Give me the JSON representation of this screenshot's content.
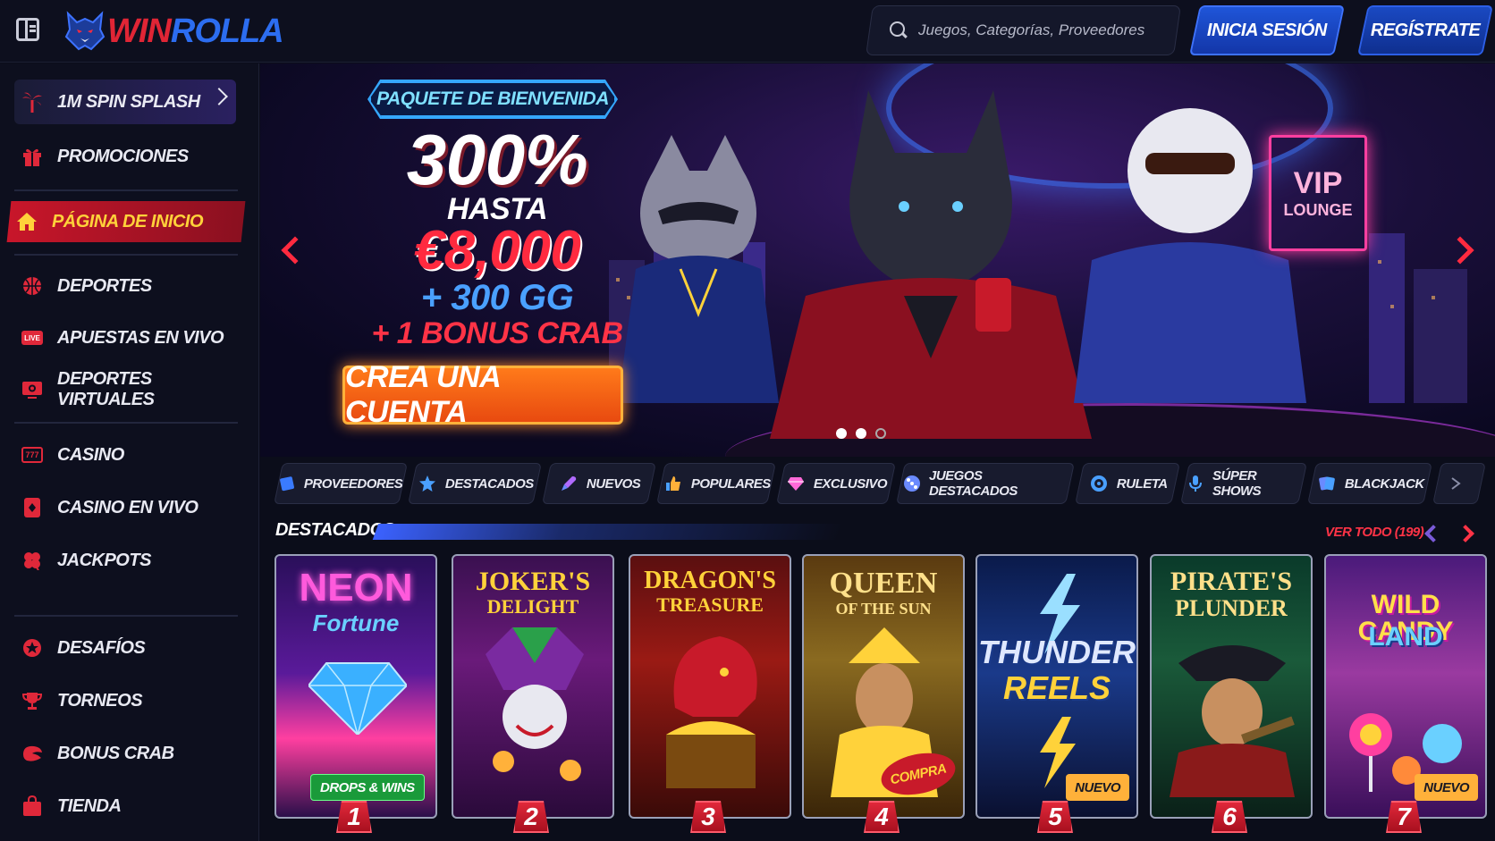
{
  "header": {
    "logo_win": "WIN",
    "logo_rolla": "ROLLA",
    "search_placeholder": "Juegos, Categorías, Proveedores",
    "login_label": "INICIA SESIÓN",
    "register_label": "REGÍSTRATE"
  },
  "sidebar": {
    "promo": {
      "label": "1M SPIN SPLASH",
      "icon": "palm-tree-icon"
    },
    "items": [
      {
        "label": "PROMOCIONES",
        "icon": "gift-icon"
      },
      {
        "label": "PÁGINA DE INICIO",
        "icon": "home-icon",
        "active": true
      },
      {
        "label": "DEPORTES",
        "icon": "basketball-icon"
      },
      {
        "label": "APUESTAS EN VIVO",
        "icon": "live-icon"
      },
      {
        "label": "DEPORTES VIRTUALES",
        "icon": "monitor-icon"
      },
      {
        "label": "CASINO",
        "icon": "slot-777-icon"
      },
      {
        "label": "CASINO EN VIVO",
        "icon": "card-icon"
      },
      {
        "label": "JACKPOTS",
        "icon": "clover-icon"
      },
      {
        "label": "DESAFÍOS",
        "icon": "star-badge-icon"
      },
      {
        "label": "TORNEOS",
        "icon": "trophy-icon"
      },
      {
        "label": "BONUS CRAB",
        "icon": "crab-claw-icon"
      },
      {
        "label": "TIENDA",
        "icon": "shopping-bag-icon"
      }
    ],
    "live_badge": "LIVE",
    "slot_badge": "777"
  },
  "hero": {
    "badge": "PAQUETE DE BIENVENIDA",
    "percent": "300%",
    "upto": "HASTA",
    "amount": "€8,000",
    "gg": "+ 300 GG",
    "crab": "+ 1 BONUS CRAB",
    "cta": "CREA UNA CUENTA",
    "vip_big": "VIP",
    "vip_small": "LOUNGE",
    "slides_total": 3,
    "slide_active": 2
  },
  "tabs": [
    {
      "label": "PROVEEDORES",
      "icon": "provider-icon",
      "color": "#3a7bff"
    },
    {
      "label": "DESTACADOS",
      "icon": "star-icon",
      "color": "#4aa0ff"
    },
    {
      "label": "NUEVOS",
      "icon": "rocket-icon",
      "color": "#b06aff"
    },
    {
      "label": "POPULARES",
      "icon": "thumbs-up-icon",
      "color": "#4aa0ff"
    },
    {
      "label": "EXCLUSIVO",
      "icon": "diamond-icon",
      "color": "#ff6ad8"
    },
    {
      "label": "JUEGOS DESTACADOS",
      "icon": "dice-icon",
      "color": "#6a8aff"
    },
    {
      "label": "RULETA",
      "icon": "roulette-icon",
      "color": "#4aa0ff"
    },
    {
      "label": "SÚPER SHOWS",
      "icon": "microphone-icon",
      "color": "#4aa0ff"
    },
    {
      "label": "BLACKJACK",
      "icon": "blackjack-icon",
      "color": "#6a8aff"
    }
  ],
  "featured": {
    "title": "DESTACADOS",
    "see_all": "VER TODO (199)",
    "games": [
      {
        "title1": "NEON",
        "title2": "Fortune",
        "badge": "DROPS & WINS",
        "rank": "1"
      },
      {
        "title1": "JOKER'S",
        "title2": "DELIGHT",
        "badge": "",
        "rank": "2"
      },
      {
        "title1": "DRAGON'S",
        "title2": "TREASURE",
        "badge": "",
        "rank": "3"
      },
      {
        "title1": "QUEEN",
        "title2": "OF THE SUN",
        "badge": "COMPRA",
        "rank": "4"
      },
      {
        "title1": "THUNDER",
        "title2": "REELS",
        "badge": "NUEVO",
        "rank": "5"
      },
      {
        "title1": "PIRATE'S",
        "title2": "PLUNDER",
        "badge": "",
        "rank": "6"
      },
      {
        "title1": "WILD CANDY",
        "title2": "LAND",
        "badge": "NUEVO",
        "rank": "7"
      }
    ]
  },
  "colors": {
    "accent_red": "#e0283a",
    "accent_blue": "#2c6df0",
    "active_gold": "#ffd23a",
    "bg": "#0b0d1a"
  }
}
